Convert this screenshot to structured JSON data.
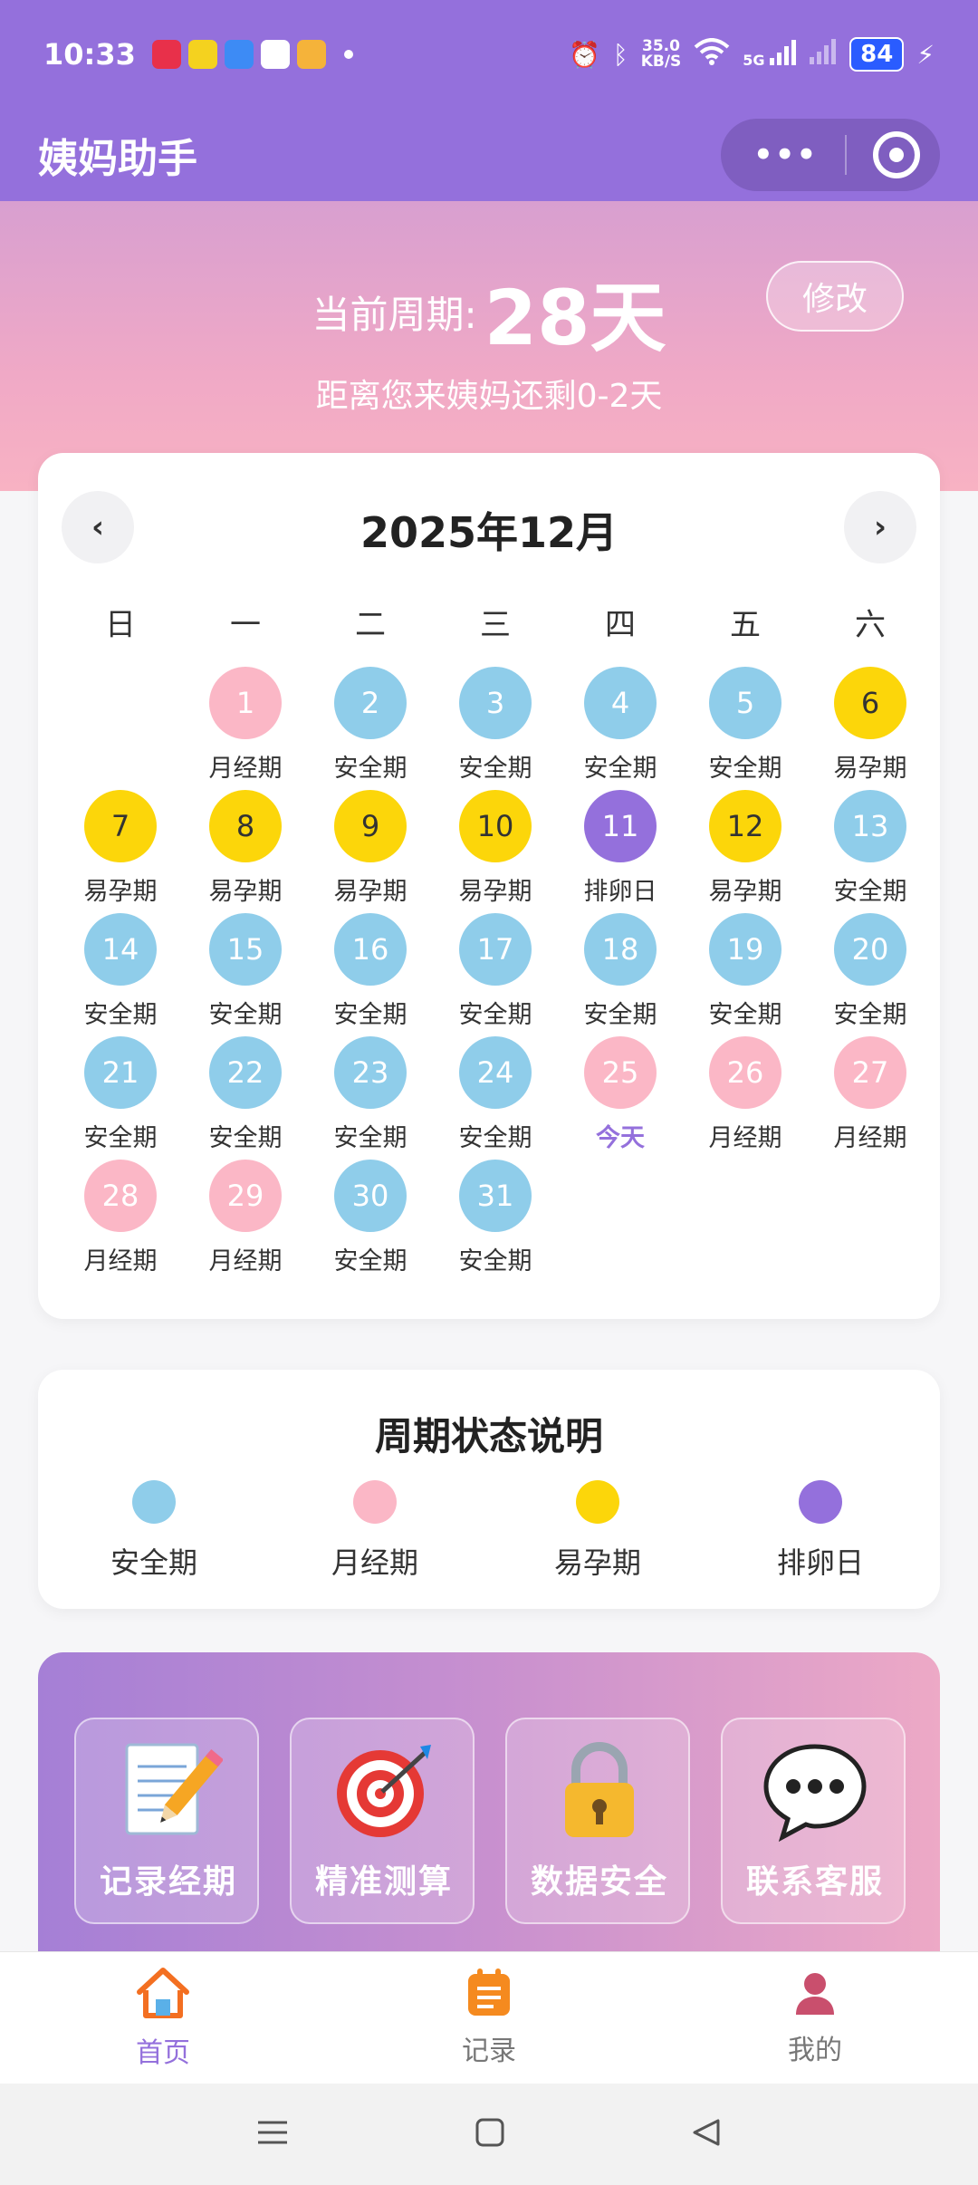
{
  "status_bar": {
    "time": "10:33",
    "net_speed_value": "35.0",
    "net_speed_unit": "KB/S",
    "network": "5G",
    "battery": "84"
  },
  "header": {
    "title": "姨妈助手"
  },
  "hero": {
    "cycle_label": "当前周期:",
    "cycle_value": "28天",
    "edit_label": "修改",
    "countdown": "距离您来姨妈还剩0-2天"
  },
  "colors": {
    "accent": "#9470dc",
    "safe": "#8fcdea",
    "period": "#fbb7c6",
    "fertile": "#fcd60a",
    "ovulation": "#9470dc"
  },
  "calendar": {
    "month_title": "2025年12月",
    "prev_label": "‹",
    "next_label": "›",
    "weekdays": [
      "日",
      "一",
      "二",
      "三",
      "四",
      "五",
      "六"
    ],
    "first_weekday_index": 1,
    "days": [
      {
        "day": "1",
        "label": "月经期",
        "type": "period"
      },
      {
        "day": "2",
        "label": "安全期",
        "type": "safe"
      },
      {
        "day": "3",
        "label": "安全期",
        "type": "safe"
      },
      {
        "day": "4",
        "label": "安全期",
        "type": "safe"
      },
      {
        "day": "5",
        "label": "安全期",
        "type": "safe"
      },
      {
        "day": "6",
        "label": "易孕期",
        "type": "fertile"
      },
      {
        "day": "7",
        "label": "易孕期",
        "type": "fertile"
      },
      {
        "day": "8",
        "label": "易孕期",
        "type": "fertile"
      },
      {
        "day": "9",
        "label": "易孕期",
        "type": "fertile"
      },
      {
        "day": "10",
        "label": "易孕期",
        "type": "fertile"
      },
      {
        "day": "11",
        "label": "排卵日",
        "type": "ovulation"
      },
      {
        "day": "12",
        "label": "易孕期",
        "type": "fertile"
      },
      {
        "day": "13",
        "label": "安全期",
        "type": "safe"
      },
      {
        "day": "14",
        "label": "安全期",
        "type": "safe"
      },
      {
        "day": "15",
        "label": "安全期",
        "type": "safe"
      },
      {
        "day": "16",
        "label": "安全期",
        "type": "safe"
      },
      {
        "day": "17",
        "label": "安全期",
        "type": "safe"
      },
      {
        "day": "18",
        "label": "安全期",
        "type": "safe"
      },
      {
        "day": "19",
        "label": "安全期",
        "type": "safe"
      },
      {
        "day": "20",
        "label": "安全期",
        "type": "safe"
      },
      {
        "day": "21",
        "label": "安全期",
        "type": "safe"
      },
      {
        "day": "22",
        "label": "安全期",
        "type": "safe"
      },
      {
        "day": "23",
        "label": "安全期",
        "type": "safe"
      },
      {
        "day": "24",
        "label": "安全期",
        "type": "safe"
      },
      {
        "day": "25",
        "label": "今天",
        "type": "period",
        "today": true
      },
      {
        "day": "26",
        "label": "月经期",
        "type": "period"
      },
      {
        "day": "27",
        "label": "月经期",
        "type": "period"
      },
      {
        "day": "28",
        "label": "月经期",
        "type": "period"
      },
      {
        "day": "29",
        "label": "月经期",
        "type": "period"
      },
      {
        "day": "30",
        "label": "安全期",
        "type": "safe"
      },
      {
        "day": "31",
        "label": "安全期",
        "type": "safe"
      }
    ]
  },
  "legend": {
    "title": "周期状态说明",
    "items": [
      {
        "label": "安全期",
        "type": "safe"
      },
      {
        "label": "月经期",
        "type": "period"
      },
      {
        "label": "易孕期",
        "type": "fertile"
      },
      {
        "label": "排卵日",
        "type": "ovulation"
      }
    ]
  },
  "features": [
    {
      "label": "记录经期",
      "icon": "memo-pencil-icon"
    },
    {
      "label": "精准测算",
      "icon": "target-dart-icon"
    },
    {
      "label": "数据安全",
      "icon": "padlock-icon"
    },
    {
      "label": "联系客服",
      "icon": "speech-bubble-icon"
    }
  ],
  "tabs": [
    {
      "label": "首页",
      "icon": "home-icon",
      "active": true
    },
    {
      "label": "记录",
      "icon": "notepad-icon",
      "active": false
    },
    {
      "label": "我的",
      "icon": "user-icon",
      "active": false
    }
  ]
}
